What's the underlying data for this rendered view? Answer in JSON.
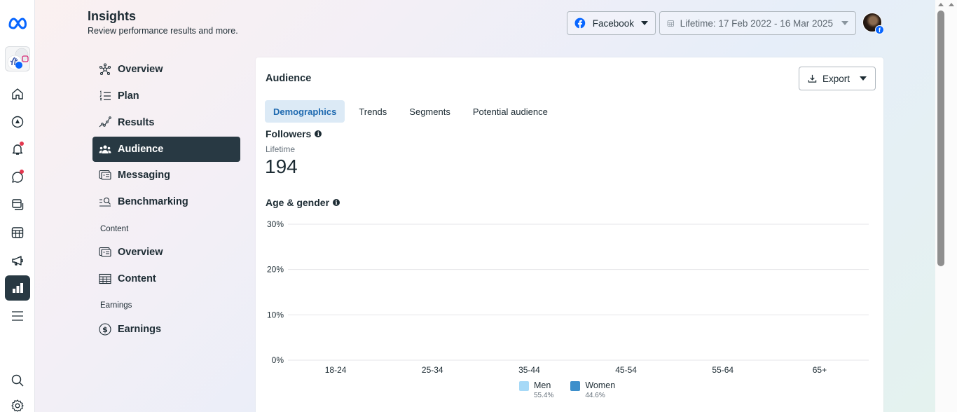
{
  "rail": {
    "items": [
      {
        "name": "home",
        "icon": "home-icon"
      },
      {
        "name": "explore",
        "icon": "compass-icon"
      },
      {
        "name": "notifications",
        "icon": "bell-icon",
        "badge": true
      },
      {
        "name": "inbox",
        "icon": "chat-bubble-icon",
        "badge": true
      },
      {
        "name": "content",
        "icon": "pages-icon"
      },
      {
        "name": "planner",
        "icon": "calendar-grid-icon"
      },
      {
        "name": "ads",
        "icon": "megaphone-icon"
      },
      {
        "name": "insights",
        "icon": "bar-chart-icon",
        "active": true
      },
      {
        "name": "all-tools",
        "icon": "menu-icon"
      },
      {
        "name": "search",
        "icon": "search-icon"
      },
      {
        "name": "settings",
        "icon": "gear-icon"
      }
    ]
  },
  "header": {
    "title": "Insights",
    "subtitle": "Review performance results and more.",
    "platform_selector": "Facebook",
    "date_range": "Lifetime: 17 Feb 2022 - 16 Mar 2025"
  },
  "nav": {
    "items": [
      {
        "label": "Overview",
        "icon": "network-icon"
      },
      {
        "label": "Plan",
        "icon": "numbered-list-icon"
      },
      {
        "label": "Results",
        "icon": "trend-line-icon"
      },
      {
        "label": "Audience",
        "icon": "people-icon",
        "active": true
      },
      {
        "label": "Messaging",
        "icon": "cards-icon"
      },
      {
        "label": "Benchmarking",
        "icon": "magnify-list-icon"
      }
    ],
    "content_section": "Content",
    "content_items": [
      {
        "label": "Overview",
        "icon": "cards-icon"
      },
      {
        "label": "Content",
        "icon": "table-icon"
      }
    ],
    "earnings_section": "Earnings",
    "earnings_items": [
      {
        "label": "Earnings",
        "icon": "dollar-circle-icon"
      }
    ]
  },
  "card": {
    "title": "Audience",
    "export_label": "Export",
    "tabs": [
      {
        "label": "Demographics",
        "active": true
      },
      {
        "label": "Trends"
      },
      {
        "label": "Segments"
      },
      {
        "label": "Potential audience"
      }
    ],
    "followers": {
      "label": "Followers",
      "period": "Lifetime",
      "value": "194"
    },
    "age_gender_label": "Age & gender"
  },
  "chart_data": {
    "type": "bar",
    "title": "Age & gender",
    "categories": [
      "18-24",
      "25-34",
      "35-44",
      "45-54",
      "55-64",
      "65+"
    ],
    "series": [
      {
        "name": "Men",
        "share": "55.4%",
        "color": "#a6d9f7",
        "values": [
          null,
          null,
          null,
          null,
          null,
          null
        ]
      },
      {
        "name": "Women",
        "share": "44.6%",
        "color": "#3d8fcb",
        "values": [
          null,
          null,
          null,
          null,
          null,
          null
        ]
      }
    ],
    "yticks": [
      "0%",
      "10%",
      "20%",
      "30%"
    ],
    "ylim": [
      0,
      30
    ],
    "grid": true,
    "legend": "bottom-center"
  },
  "colors": {
    "active_nav_bg": "#283943",
    "tab_active_bg": "#dceaf6",
    "tab_active_text": "#1f6ab0",
    "facebook_blue": "#0866ff",
    "notification_red": "#e4374f"
  }
}
